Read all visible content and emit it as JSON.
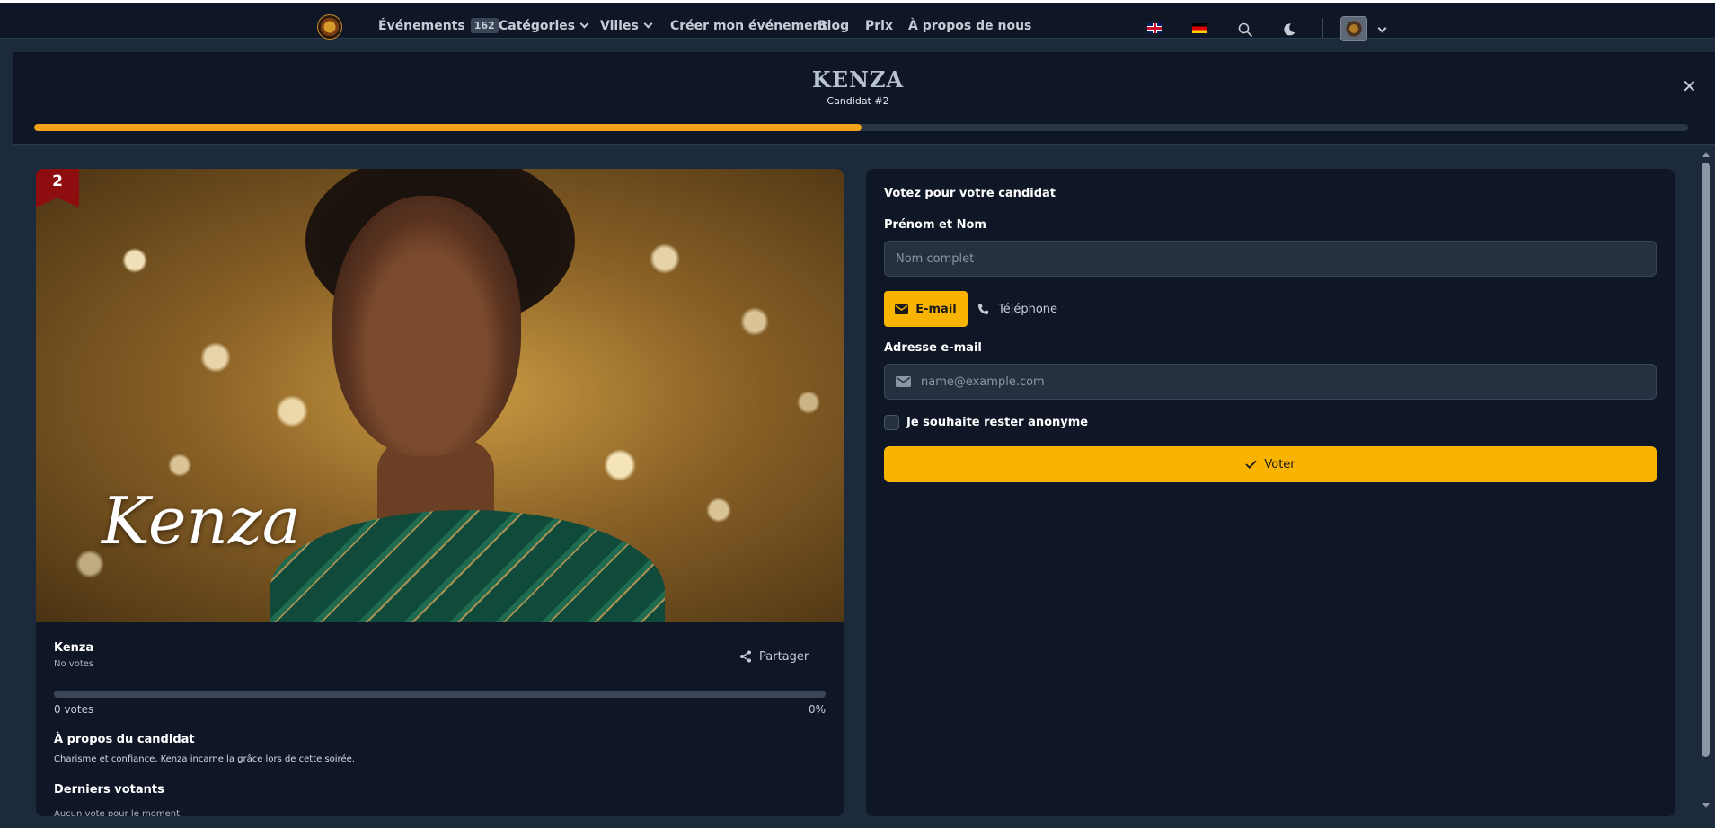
{
  "nav": {
    "logo_icon": "event-logo-icon",
    "items": [
      {
        "label": "Événements",
        "badge": "162"
      },
      {
        "label": "Catégories"
      },
      {
        "label": "Villes"
      },
      {
        "label": "Créer mon événement"
      },
      {
        "label": "Blog"
      },
      {
        "label": "Prix"
      },
      {
        "label": "À propos de nous"
      }
    ],
    "languages": [
      "uk-flag-icon",
      "de-flag-icon"
    ],
    "icons": [
      "search-icon",
      "moon-icon",
      "avatar",
      "chevron-down-icon"
    ]
  },
  "header": {
    "title": "KENZA",
    "subtitle": "Candidat #2",
    "close_icon": "close-icon",
    "progress": 0.5
  },
  "candidate": {
    "number": "2",
    "photo_name": "Kenza",
    "name": "Kenza",
    "votes_sub": "No votes",
    "share_label": "Partager",
    "vote_fraction": 0,
    "votes_count": "0 votes",
    "votes_pct": "0%",
    "about_title": "À propos du candidat",
    "about_text": "Charisme et confiance, Kenza incarne la grâce lors de cette soirée.",
    "voters_title": "Derniers votants",
    "voters_empty": "Aucun vote pour le moment"
  },
  "form": {
    "title": "Votez pour votre candidat",
    "name_label": "Prénom et Nom",
    "name_placeholder": "Nom complet",
    "tab_email": "E-mail",
    "tab_phone": "Téléphone",
    "email_label": "Adresse e-mail",
    "email_placeholder": "name@example.com",
    "anonymous_label": "Je souhaite rester anonyme",
    "submit_label": "Voter"
  },
  "colors": {
    "accent": "#f9b402",
    "progress": "#f5a21b",
    "background": "#1c2a3b",
    "panel": "#0f1727",
    "ribbon": "#8e0e10"
  }
}
